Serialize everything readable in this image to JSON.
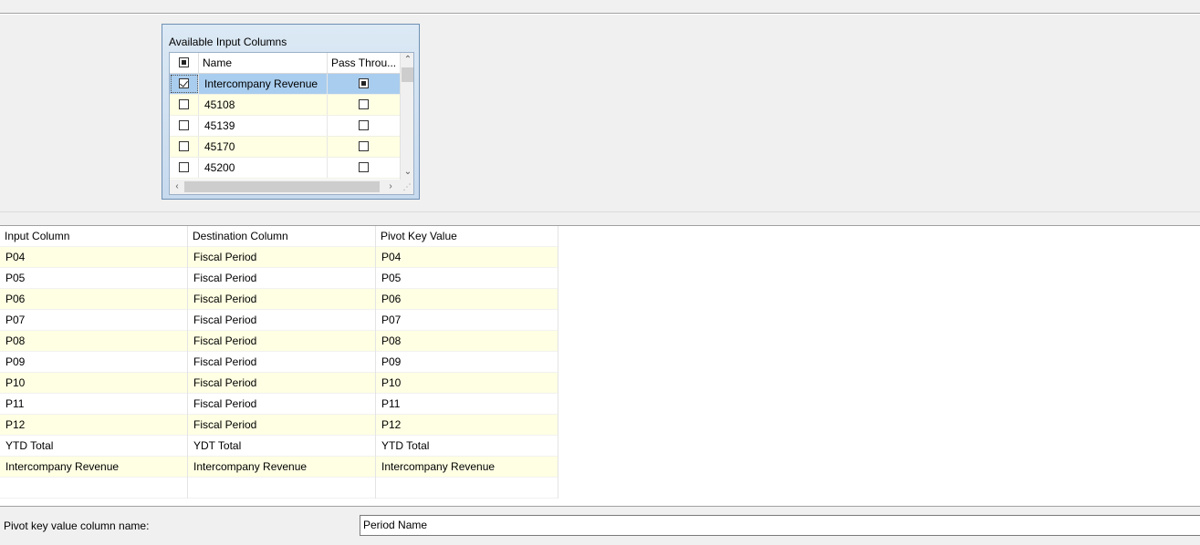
{
  "available_columns": {
    "title": "Available Input Columns",
    "headers": {
      "name": "Name",
      "pass_through": "Pass Throu..."
    },
    "rows": [
      {
        "name": "Intercompany Revenue",
        "selected": true,
        "pass_through": true
      },
      {
        "name": "45108",
        "selected": false,
        "pass_through": false
      },
      {
        "name": "45139",
        "selected": false,
        "pass_through": false
      },
      {
        "name": "45170",
        "selected": false,
        "pass_through": false
      },
      {
        "name": "45200",
        "selected": false,
        "pass_through": false
      }
    ]
  },
  "mapping": {
    "headers": [
      "Input Column",
      "Destination Column",
      "Pivot Key Value"
    ],
    "rows": [
      [
        "P04",
        "Fiscal Period",
        "P04"
      ],
      [
        "P05",
        "Fiscal Period",
        "P05"
      ],
      [
        "P06",
        "Fiscal Period",
        "P06"
      ],
      [
        "P07",
        "Fiscal Period",
        "P07"
      ],
      [
        "P08",
        "Fiscal Period",
        "P08"
      ],
      [
        "P09",
        "Fiscal Period",
        "P09"
      ],
      [
        "P10",
        "Fiscal Period",
        "P10"
      ],
      [
        "P11",
        "Fiscal Period",
        "P11"
      ],
      [
        "P12",
        "Fiscal Period",
        "P12"
      ],
      [
        "YTD Total",
        "YDT Total",
        "YTD Total"
      ],
      [
        "Intercompany Revenue",
        "Intercompany Revenue",
        "Intercompany Revenue"
      ]
    ]
  },
  "pivot_key": {
    "label": "Pivot key value column name:",
    "value": "Period Name"
  }
}
